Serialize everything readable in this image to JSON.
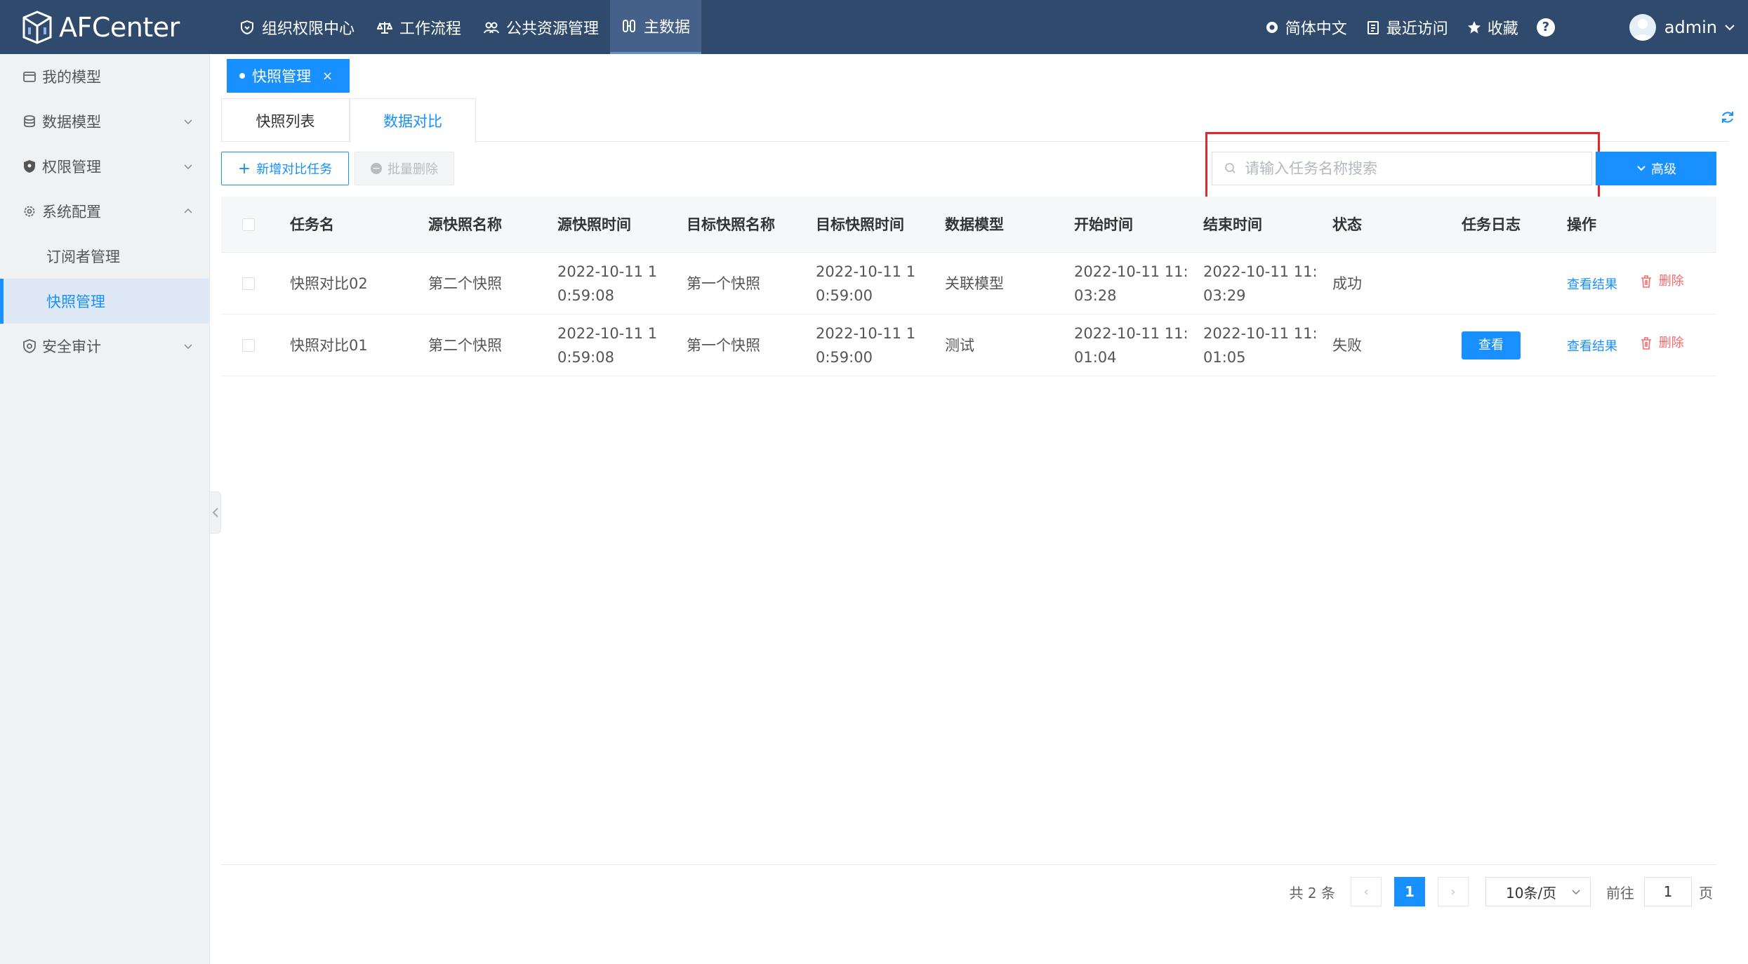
{
  "header": {
    "app_name": "AFCenter",
    "nav": [
      {
        "label": "组织权限中心",
        "icon": "shield-icon"
      },
      {
        "label": "工作流程",
        "icon": "flow-icon"
      },
      {
        "label": "公共资源管理",
        "icon": "users-icon"
      },
      {
        "label": "主数据",
        "icon": "data-icon",
        "active": true
      }
    ],
    "language": "简体中文",
    "recent": "最近访问",
    "favorites": "收藏",
    "help": "?",
    "user": "admin"
  },
  "sidebar": {
    "items": [
      {
        "label": "我的模型",
        "icon": "wallet-icon"
      },
      {
        "label": "数据模型",
        "icon": "database-icon",
        "expandable": true
      },
      {
        "label": "权限管理",
        "icon": "shield-icon",
        "expandable": true
      },
      {
        "label": "系统配置",
        "icon": "gear-icon",
        "expandable": true,
        "expanded": true,
        "children": [
          {
            "label": "订阅者管理"
          },
          {
            "label": "快照管理",
            "active": true
          }
        ]
      },
      {
        "label": "安全审计",
        "icon": "audit-icon",
        "expandable": true
      }
    ]
  },
  "page_tab": {
    "label": "快照管理",
    "close": "×"
  },
  "subtabs": [
    {
      "label": "快照列表",
      "active": false
    },
    {
      "label": "数据对比",
      "active": true
    }
  ],
  "toolbar": {
    "add_label": "新增对比任务",
    "batch_delete_label": "批量删除",
    "search_placeholder": "请输入任务名称搜索",
    "search_value": "",
    "advanced_label": "高级"
  },
  "table": {
    "columns": [
      "任务名",
      "源快照名称",
      "源快照时间",
      "目标快照名称",
      "目标快照时间",
      "数据模型",
      "开始时间",
      "结束时间",
      "状态",
      "任务日志",
      "操作"
    ],
    "rows": [
      {
        "name": "快照对比02",
        "source_name": "第二个快照",
        "source_time_1": "2022-10-11 1",
        "source_time_2": "0:59:08",
        "target_name": "第一个快照",
        "target_time_1": "2022-10-11 1",
        "target_time_2": "0:59:00",
        "model": "关联模型",
        "start_1": "2022-10-11 11:",
        "start_2": "03:28",
        "end_1": "2022-10-11 11:",
        "end_2": "03:29",
        "status": "成功",
        "log_button": "",
        "view_result": "查看结果",
        "delete": "删除"
      },
      {
        "name": "快照对比01",
        "source_name": "第二个快照",
        "source_time_1": "2022-10-11 1",
        "source_time_2": "0:59:08",
        "target_name": "第一个快照",
        "target_time_1": "2022-10-11 1",
        "target_time_2": "0:59:00",
        "model": "测试",
        "start_1": "2022-10-11 11:",
        "start_2": "01:04",
        "end_1": "2022-10-11 11:",
        "end_2": "01:05",
        "status": "失败",
        "log_button": "查看",
        "view_result": "查看结果",
        "delete": "删除"
      }
    ]
  },
  "pagination": {
    "total": "共 2 条",
    "current_page": "1",
    "prev": "‹",
    "next": "›",
    "page_size": "10条/页",
    "goto_label": "前往",
    "goto_value": "1",
    "page_suffix": "页"
  },
  "colors": {
    "header_bg": "#2f4a6d",
    "accent": "#1890ff",
    "danger": "#f56c6c",
    "highlight_box": "#e0282e"
  }
}
